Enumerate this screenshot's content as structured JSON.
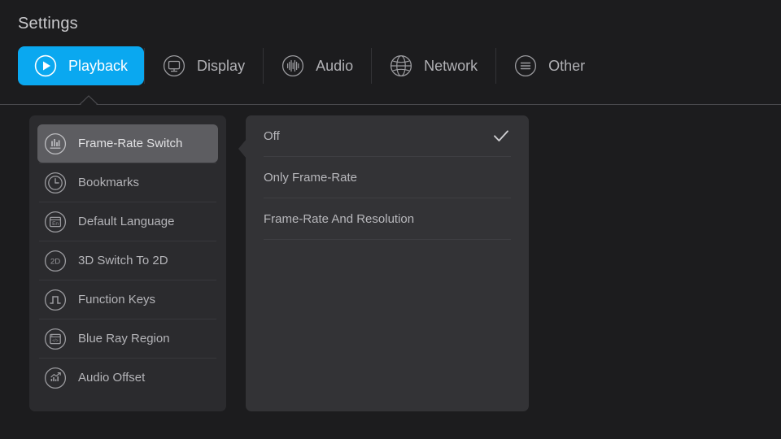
{
  "page_title": "Settings",
  "theme": {
    "background": "#1c1c1e",
    "accent": "#0aa8f0",
    "sidebar_panel_bg": "#2b2b2e",
    "options_panel_bg": "#333336",
    "selected_item_bg": "#5d5d61",
    "text_primary": "#e2e2e4",
    "text_secondary": "#b4b4b8",
    "divider": "#4a4a4e"
  },
  "tabs": [
    {
      "label": "Playback",
      "icon": "play-circle-icon",
      "active": true
    },
    {
      "label": "Display",
      "icon": "monitor-icon",
      "active": false
    },
    {
      "label": "Audio",
      "icon": "audio-wave-icon",
      "active": false
    },
    {
      "label": "Network",
      "icon": "globe-icon",
      "active": false
    },
    {
      "label": "Other",
      "icon": "menu-lines-icon",
      "active": false
    }
  ],
  "sidebar": {
    "items": [
      {
        "label": "Frame-Rate Switch",
        "icon": "bar-chart-icon",
        "selected": true
      },
      {
        "label": "Bookmarks",
        "icon": "clock-icon",
        "selected": false
      },
      {
        "label": "Default Language",
        "icon": "language-en-icon",
        "selected": false
      },
      {
        "label": "3D Switch To 2D",
        "icon": "two-d-icon",
        "selected": false
      },
      {
        "label": "Function Keys",
        "icon": "square-wave-icon",
        "selected": false
      },
      {
        "label": "Blue Ray Region",
        "icon": "code-window-icon",
        "selected": false
      },
      {
        "label": "Audio Offset",
        "icon": "chart-arrow-icon",
        "selected": false
      }
    ]
  },
  "options": {
    "items": [
      {
        "label": "Off",
        "checked": true
      },
      {
        "label": "Only Frame-Rate",
        "checked": false
      },
      {
        "label": "Frame-Rate And Resolution",
        "checked": false
      }
    ]
  }
}
